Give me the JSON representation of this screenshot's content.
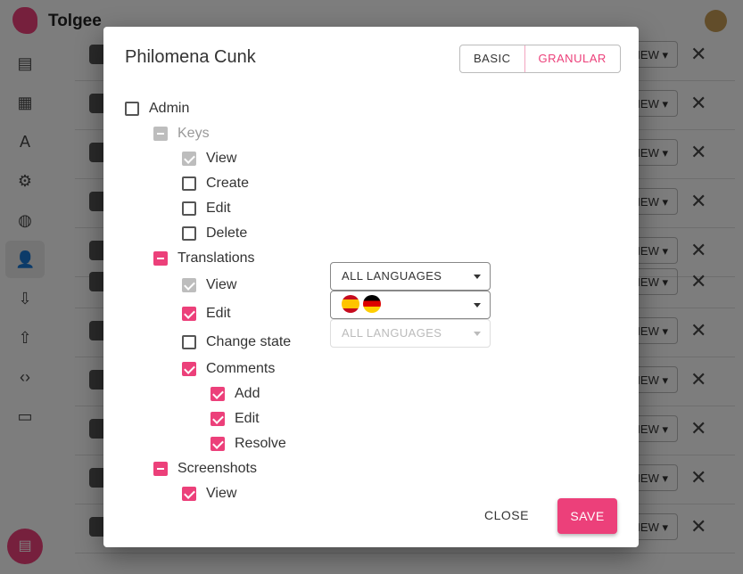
{
  "app": {
    "brand": "Tolgee"
  },
  "sidebar": {
    "icons": [
      "translations-icon",
      "dashboard-icon",
      "languages-icon",
      "settings-icon",
      "globe-icon",
      "members-icon",
      "import-icon",
      "export-icon",
      "integrate-icon",
      "devices-icon"
    ]
  },
  "background_rows": {
    "permission_label": "VIEW"
  },
  "dialog": {
    "title": "Philomena Cunk",
    "mode_basic": "BASIC",
    "mode_granular": "GRANULAR",
    "items": [
      {
        "label": "Admin",
        "state": "unchecked",
        "level": 0
      },
      {
        "label": "Keys",
        "state": "indeterminate-disabled",
        "level": 1
      },
      {
        "label": "View",
        "state": "checked-disabled",
        "level": 2
      },
      {
        "label": "Create",
        "state": "unchecked",
        "level": 2
      },
      {
        "label": "Edit",
        "state": "unchecked",
        "level": 2
      },
      {
        "label": "Delete",
        "state": "unchecked",
        "level": 2
      },
      {
        "label": "Translations",
        "state": "indeterminate",
        "level": 1
      },
      {
        "label": "View",
        "state": "checked-disabled",
        "level": 2
      },
      {
        "label": "Edit",
        "state": "checked",
        "level": 2
      },
      {
        "label": "Change state",
        "state": "unchecked",
        "level": 2
      },
      {
        "label": "Comments",
        "state": "checked",
        "level": 2
      },
      {
        "label": "Add",
        "state": "checked",
        "level": 3
      },
      {
        "label": "Edit",
        "state": "checked",
        "level": 3
      },
      {
        "label": "Resolve",
        "state": "checked",
        "level": 3
      },
      {
        "label": "Screenshots",
        "state": "indeterminate",
        "level": 1
      },
      {
        "label": "View",
        "state": "checked",
        "level": 2
      }
    ],
    "selects": {
      "view_languages": "ALL LANGUAGES",
      "edit_languages": [
        "es-flag",
        "de-flag"
      ],
      "state_languages": "ALL LANGUAGES"
    },
    "close_label": "CLOSE",
    "save_label": "SAVE"
  },
  "colors": {
    "accent": "#ec407a",
    "disabled": "#bdbdbd"
  }
}
